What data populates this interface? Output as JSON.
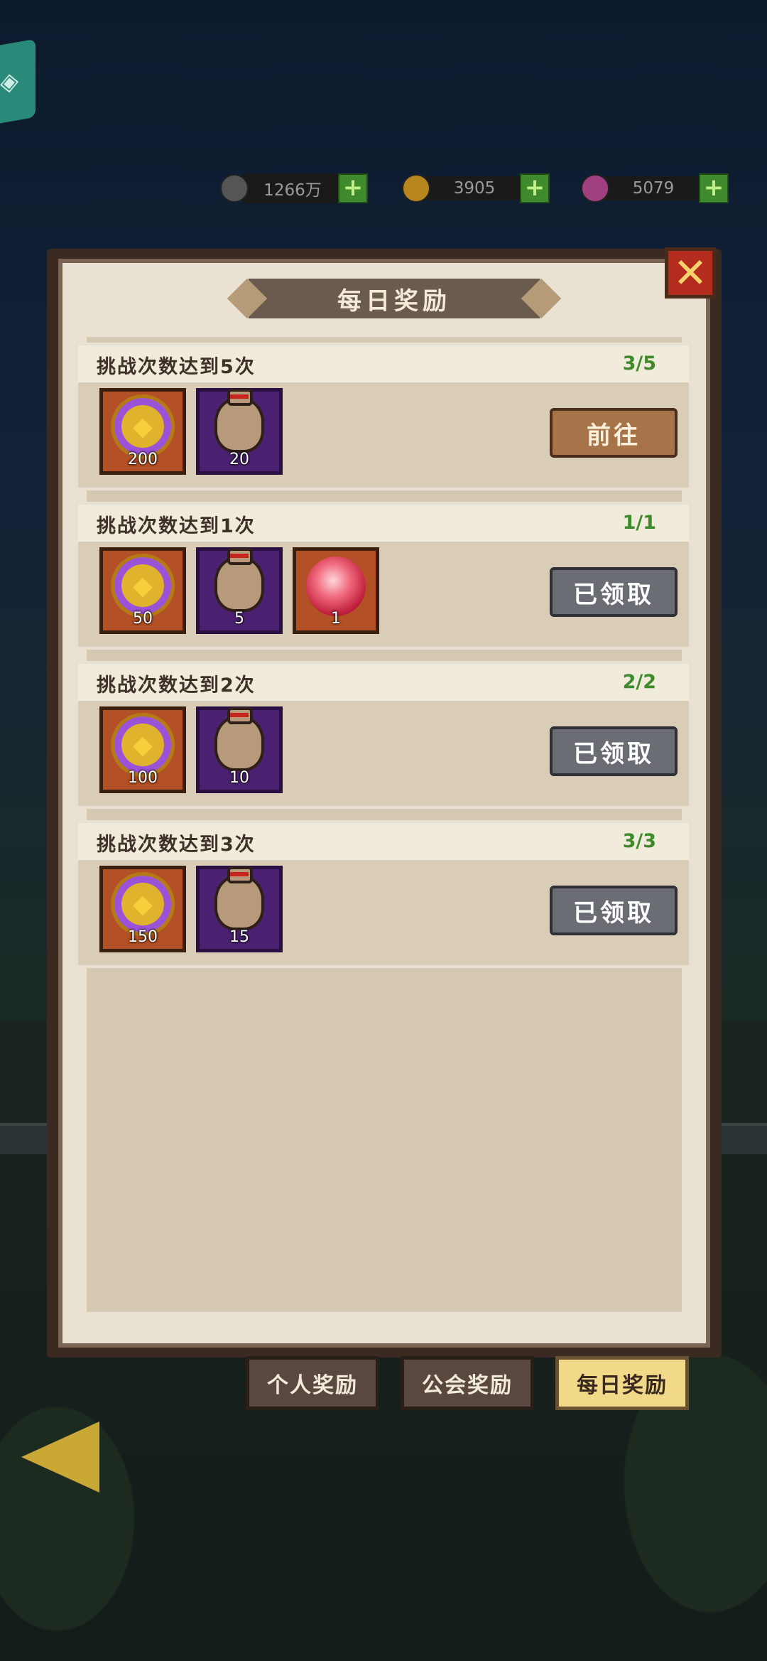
{
  "resources": [
    {
      "value": "1266万",
      "plus": "+"
    },
    {
      "value": "3905",
      "plus": "+"
    },
    {
      "value": "5079",
      "plus": "+"
    }
  ],
  "panel": {
    "title": "每日奖励",
    "close": "✕"
  },
  "tasks": [
    {
      "name": "挑战次数达到5次",
      "progress": "3/5",
      "button": "前往",
      "items": [
        {
          "icon": "purple-coin-icon",
          "qty": "200"
        },
        {
          "icon": "bag-icon",
          "qty": "20"
        }
      ]
    },
    {
      "name": "挑战次数达到1次",
      "progress": "1/1",
      "button": "已领取",
      "items": [
        {
          "icon": "purple-coin-icon",
          "qty": "50"
        },
        {
          "icon": "bag-icon",
          "qty": "5"
        },
        {
          "icon": "red-orb-icon",
          "qty": "1"
        }
      ]
    },
    {
      "name": "挑战次数达到2次",
      "progress": "2/2",
      "button": "已领取",
      "items": [
        {
          "icon": "purple-coin-icon",
          "qty": "100"
        },
        {
          "icon": "bag-icon",
          "qty": "10"
        }
      ]
    },
    {
      "name": "挑战次数达到3次",
      "progress": "3/3",
      "button": "已领取",
      "items": [
        {
          "icon": "purple-coin-icon",
          "qty": "150"
        },
        {
          "icon": "bag-icon",
          "qty": "15"
        }
      ]
    }
  ],
  "tabs": [
    {
      "label": "个人奖励"
    },
    {
      "label": "公会奖励"
    },
    {
      "label": "每日奖励",
      "active": true
    }
  ]
}
